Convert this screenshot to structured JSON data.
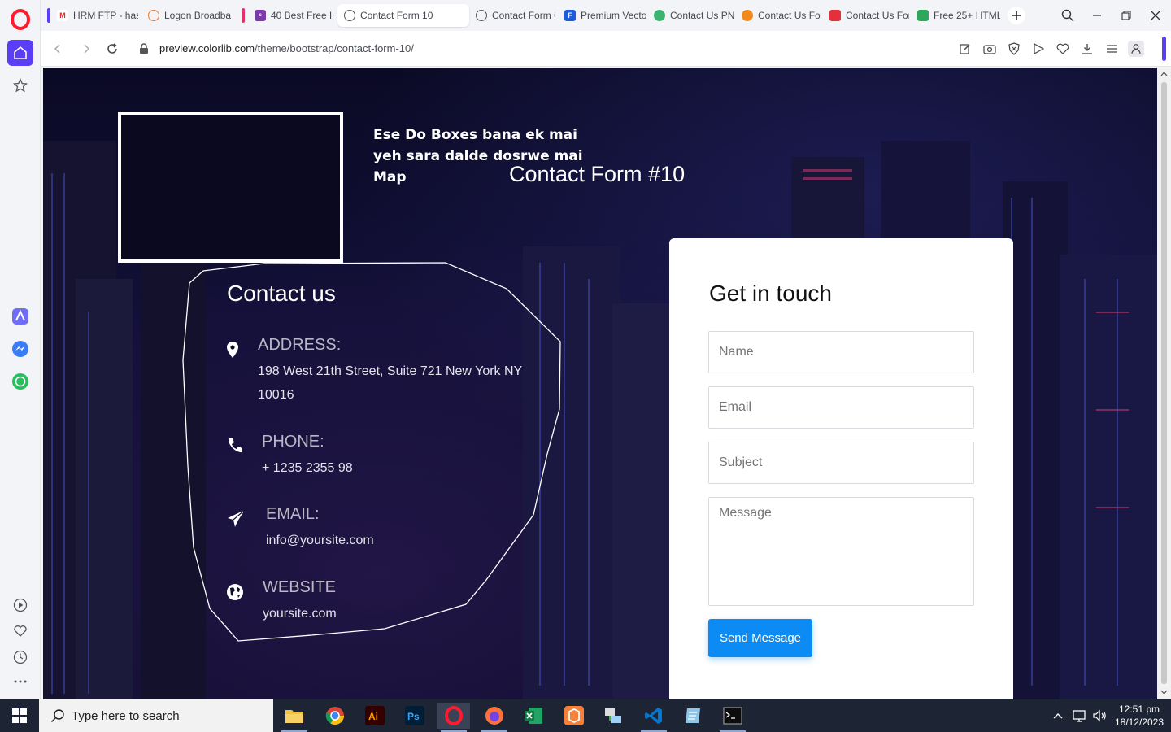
{
  "browser": {
    "tabs": [
      {
        "label": "HRM FTP - has",
        "favicon": "gmail-icon",
        "stripe": "#5a3df5"
      },
      {
        "label": "Logon Broadba",
        "favicon": "broadband-icon",
        "stripe": ""
      },
      {
        "label": "40 Best Free H",
        "favicon": "colorlib-icon",
        "stripe": "#e0336a"
      },
      {
        "label": "Contact Form 10",
        "favicon": "globe-icon",
        "stripe": "",
        "active": true
      },
      {
        "label": "Contact Form C",
        "favicon": "globe-icon",
        "stripe": ""
      },
      {
        "label": "Premium Vecto",
        "favicon": "freepik-icon",
        "stripe": ""
      },
      {
        "label": "Contact Us PN",
        "favicon": "pngtree-icon",
        "stripe": ""
      },
      {
        "label": "Contact Us For",
        "favicon": "orange-icon",
        "stripe": ""
      },
      {
        "label": "Contact Us For",
        "favicon": "red-icon",
        "stripe": ""
      },
      {
        "label": "Free 25+ HTML",
        "favicon": "green-icon",
        "stripe": ""
      }
    ],
    "url_host": "preview.colorlib.com",
    "url_path": "/theme/bootstrap/contact-form-10/"
  },
  "page": {
    "note_line1": "Ese Do Boxes bana ek mai",
    "note_line2": "yeh sara dalde dosrwe mai",
    "note_line3": "Map",
    "title": "Contact Form #10",
    "contact": {
      "heading": "Contact us",
      "address_label": "ADDRESS:",
      "address_line1": "198 West 21th Street, Suite 721 New York NY",
      "address_line2": "10016",
      "phone_label": "PHONE:",
      "phone_value": "+ 1235 2355 98",
      "email_label": "EMAIL:",
      "email_value": "info@yoursite.com",
      "website_label": "WEBSITE",
      "website_value": "yoursite.com"
    },
    "form": {
      "heading": "Get in touch",
      "name_placeholder": "Name",
      "email_placeholder": "Email",
      "subject_placeholder": "Subject",
      "message_placeholder": "Message",
      "submit_label": "Send Message"
    }
  },
  "taskbar": {
    "search_placeholder": "Type here to search",
    "time": "12:51 pm",
    "date": "18/12/2023",
    "apps": [
      "file-explorer-icon",
      "chrome-icon",
      "illustrator-icon",
      "photoshop-icon",
      "opera-icon",
      "firefox-icon",
      "excel-icon",
      "app-icon",
      "network-tool-icon",
      "vscode-icon",
      "notepad-icon",
      "terminal-icon"
    ]
  },
  "colors": {
    "accent": "#0d8bf5",
    "opera_red": "#ff1b2d",
    "sidebar_active": "#5a3df5",
    "page_bg": "#0f0c2e"
  }
}
